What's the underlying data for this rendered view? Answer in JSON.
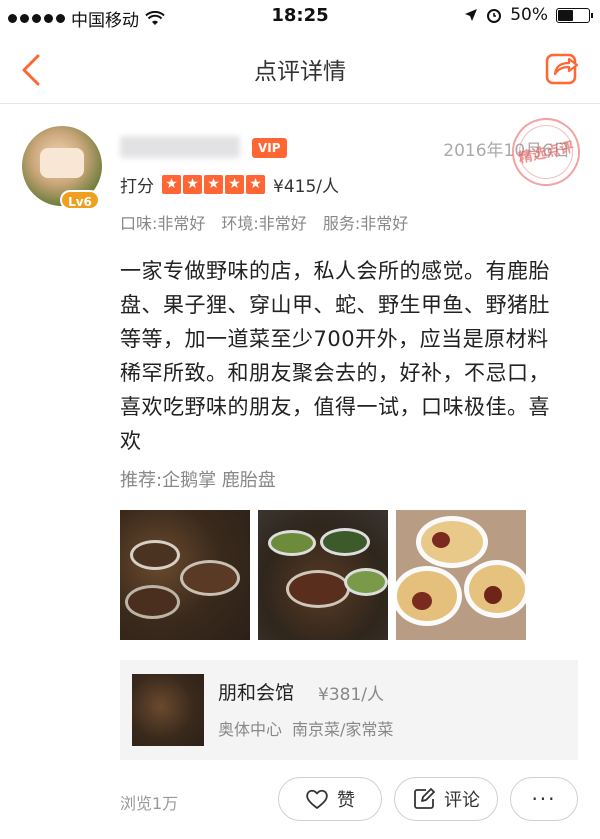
{
  "status_bar": {
    "carrier": "中国移动",
    "time": "18:25",
    "battery": "50%",
    "battery_level": 0.5,
    "icons": [
      "signal-dots-icon",
      "wifi-icon",
      "location-arrow-icon",
      "alarm-icon",
      "battery-icon"
    ]
  },
  "nav": {
    "title": "点评详情",
    "back_icon": "chevron-left-icon",
    "share_icon": "share-icon",
    "accent_color": "#ff6633"
  },
  "review": {
    "level_badge": "Lv6",
    "vip_badge": "VIP",
    "date": "2016年10月6日",
    "stamp_text": "精选点评",
    "score_label": "打分",
    "stars": 5,
    "price_per_person": "¥415/人",
    "sub_ratings": [
      "口味:非常好",
      "环境:非常好",
      "服务:非常好"
    ],
    "content": "一家专做野味的店，私人会所的感觉。有鹿胎盘、果子狸、穿山甲、蛇、野生甲鱼、野猪肚等等，加一道菜至少700开外，应当是原材料稀罕所致。和朋友聚会去的，好补，不忌口，喜欢吃野味的朋友，值得一试，口味极佳。喜欢",
    "recommend": "推荐:企鹅掌 鹿胎盘",
    "photos": [
      "photo-hotpot-table",
      "photo-hotpot-dishes",
      "photo-soup-bowls"
    ]
  },
  "shop": {
    "name": "朋和会馆",
    "price": "¥381/人",
    "area": "奥体中心",
    "category": "南京菜/家常菜"
  },
  "footer": {
    "views": "浏览1万",
    "like_label": "赞",
    "comment_label": "评论",
    "more_label": "···"
  }
}
